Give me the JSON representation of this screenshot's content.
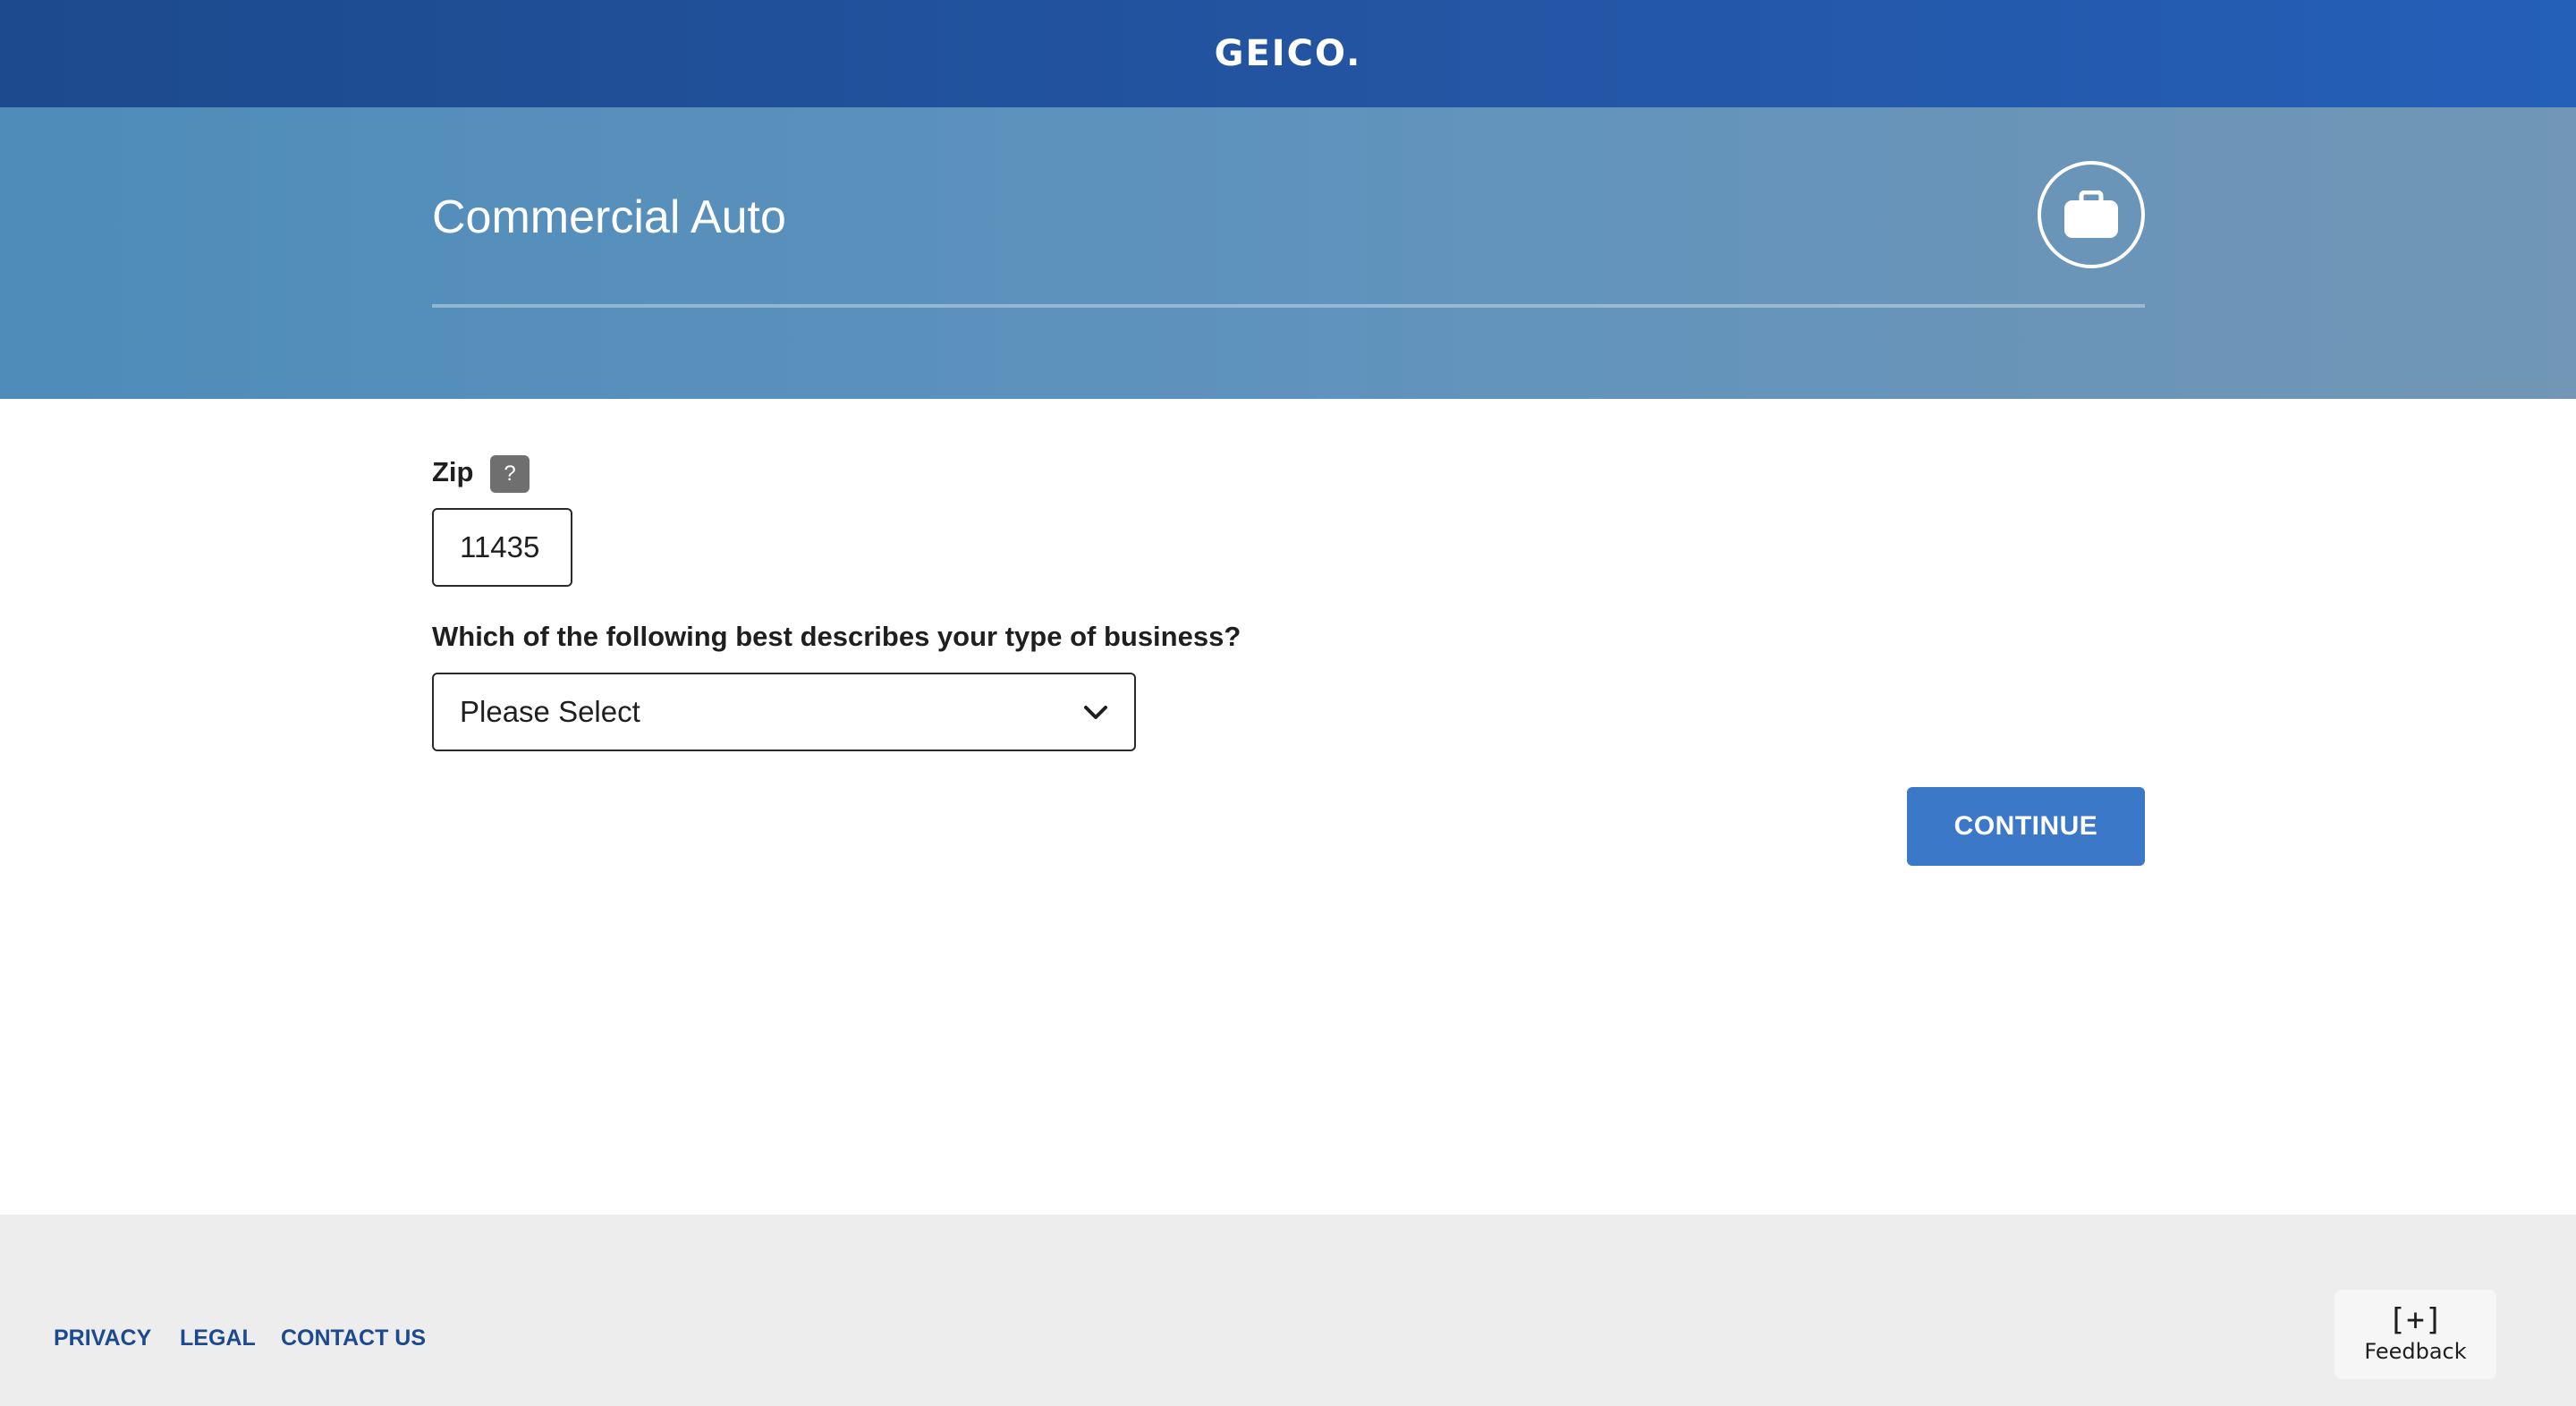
{
  "header": {
    "logo_text": "GEICO."
  },
  "hero": {
    "title": "Commercial Auto",
    "icon": "briefcase-icon"
  },
  "form": {
    "zip_label": "Zip",
    "zip_help": "?",
    "zip_value": "11435",
    "business_label": "Which of the following best describes your type of business?",
    "business_selected": "Please Select",
    "continue_label": "CONTINUE"
  },
  "footer": {
    "links": [
      "PRIVACY",
      "LEGAL",
      "CONTACT US"
    ],
    "feedback_icon": "[+]",
    "feedback_label": "Feedback"
  },
  "colors": {
    "header_bg": "#1d4a8e",
    "hero_bg": "#5f93bd",
    "button_bg": "#3b78c8",
    "footer_bg": "#ededed",
    "link": "#1d4a8e"
  }
}
